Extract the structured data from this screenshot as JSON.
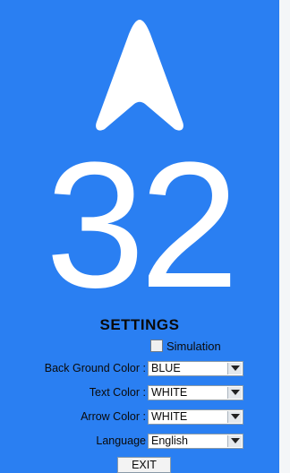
{
  "colors": {
    "background": "#2a7ff2",
    "text": "#ffffff",
    "arrow": "#ffffff"
  },
  "display": {
    "arrow_icon": "navigation-arrow-up",
    "speed": "32"
  },
  "settings": {
    "title": "SETTINGS",
    "simulation_label": "Simulation",
    "simulation_checked": false,
    "background_color": {
      "label": "Back Ground Color :",
      "value": "BLUE"
    },
    "text_color": {
      "label": "Text Color :",
      "value": "WHITE"
    },
    "arrow_color": {
      "label": "Arrow Color :",
      "value": "WHITE"
    },
    "language": {
      "label": "Language",
      "value": "English"
    },
    "exit_label": "EXIT"
  }
}
